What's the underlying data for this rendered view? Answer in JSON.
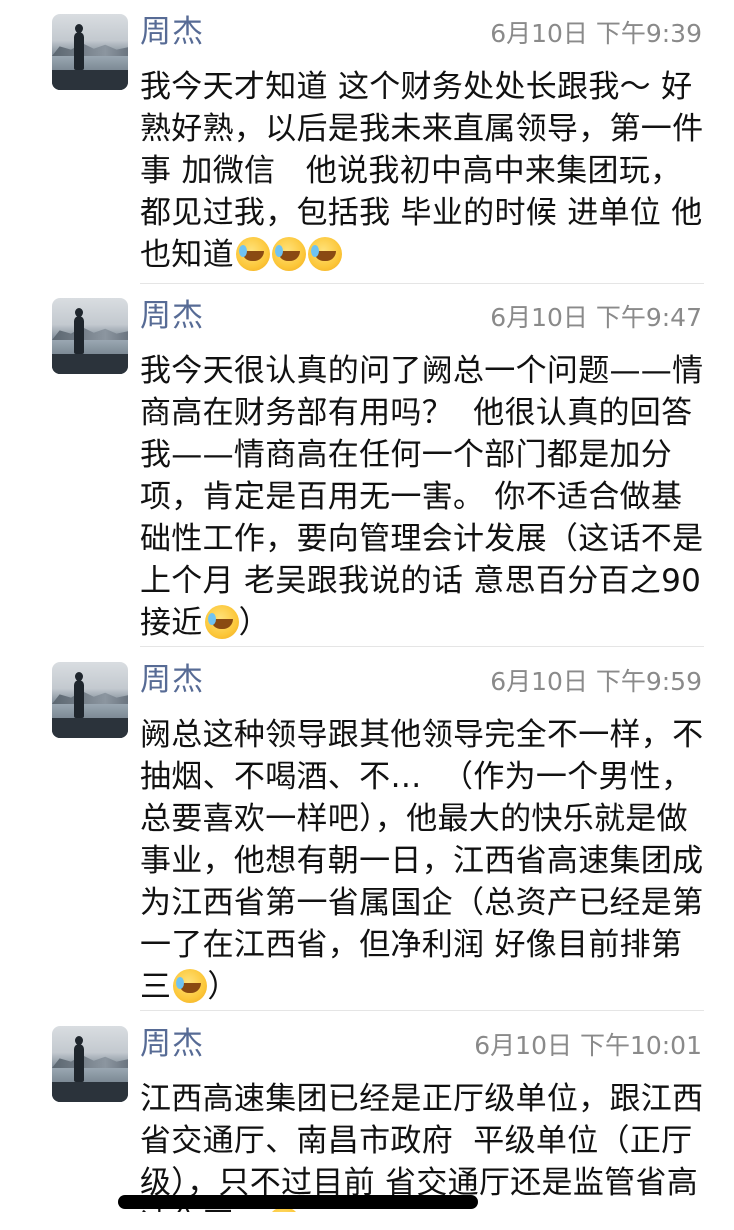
{
  "messages": [
    {
      "sender": "周杰",
      "time": "6月10日 下午9:39",
      "text_before": "我今天才知道 这个财务处处长跟我～ 好熟好熟，以后是我未来直属领导，第一件事 加微信   他说我初中高中来集团玩，都见过我，包括我 毕业的时候 进单位 他也知道",
      "emojis_inline": 3,
      "text_after": ""
    },
    {
      "sender": "周杰",
      "time": "6月10日 下午9:47",
      "text_before": "我今天很认真的问了阙总一个问题——情商高在财务部有用吗？  他很认真的回答我——情商高在任何一个部门都是加分项，肯定是百用无一害。 你不适合做基础性工作，要向管理会计发展（这话不是上个月 老吴跟我说的话 意思百分百之90接近",
      "emojis_inline": 1,
      "text_after": "）"
    },
    {
      "sender": "周杰",
      "time": "6月10日 下午9:59",
      "text_before": "阙总这种领导跟其他领导完全不一样，不抽烟、不喝酒、不…  （作为一个男性，总要喜欢一样吧），他最大的快乐就是做事业，他想有朝一日，江西省高速集团成为江西省第一省属国企（总资产已经是第一了在江西省，但净利润 好像目前排第三",
      "emojis_inline": 1,
      "text_after": "）"
    },
    {
      "sender": "周杰",
      "time": "6月10日 下午10:01",
      "text_before": "江西高速集团已经是正厅级单位，跟江西省交通厅、南昌市政府  平级单位（正厅级），只不过目前 省交通厅还是监管省高速集团。",
      "emojis_inline": 1,
      "text_after": ""
    }
  ],
  "avatar_icon": "landscape-photo-avatar",
  "emoji_icon": "tears-of-joy-emoji",
  "colors": {
    "sender_name": "#576b95",
    "timestamp": "#8a8a8a",
    "message_text": "#111111",
    "divider": "#e5e5e5",
    "background": "#ffffff"
  }
}
